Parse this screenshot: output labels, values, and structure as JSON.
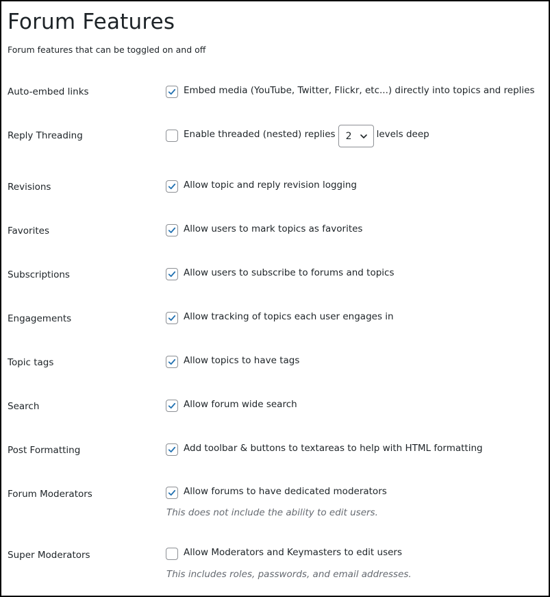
{
  "header": {
    "title": "Forum Features",
    "description": "Forum features that can be toggled on and off"
  },
  "colors": {
    "checkmark": "#2271b1",
    "text": "#1d2327",
    "hint": "#646970",
    "border": "#8c8f94"
  },
  "settings": [
    {
      "label": "Auto-embed links",
      "checked": true,
      "text": "Embed media (YouTube, Twitter, Flickr, etc...) directly into topics and replies"
    },
    {
      "label": "Reply Threading",
      "checked": false,
      "text": "Enable threaded (nested) replies",
      "select_value": "2",
      "suffix": "levels deep"
    },
    {
      "label": "Revisions",
      "checked": true,
      "text": "Allow topic and reply revision logging"
    },
    {
      "label": "Favorites",
      "checked": true,
      "text": "Allow users to mark topics as favorites"
    },
    {
      "label": "Subscriptions",
      "checked": true,
      "text": "Allow users to subscribe to forums and topics"
    },
    {
      "label": "Engagements",
      "checked": true,
      "text": "Allow tracking of topics each user engages in"
    },
    {
      "label": "Topic tags",
      "checked": true,
      "text": "Allow topics to have tags"
    },
    {
      "label": "Search",
      "checked": true,
      "text": "Allow forum wide search"
    },
    {
      "label": "Post Formatting",
      "checked": true,
      "text": "Add toolbar & buttons to textareas to help with HTML formatting"
    },
    {
      "label": "Forum Moderators",
      "checked": true,
      "text": "Allow forums to have dedicated moderators",
      "hint": "This does not include the ability to edit users."
    },
    {
      "label": "Super Moderators",
      "checked": false,
      "text": "Allow Moderators and Keymasters to edit users",
      "hint": "This includes roles, passwords, and email addresses."
    }
  ]
}
